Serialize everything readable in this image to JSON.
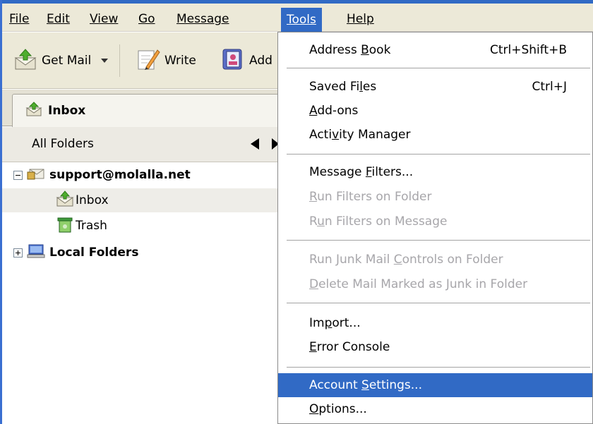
{
  "menubar": {
    "items": [
      {
        "id": "file",
        "label": "File"
      },
      {
        "id": "edit",
        "label": "Edit"
      },
      {
        "id": "view",
        "label": "View"
      },
      {
        "id": "go",
        "label": "Go"
      },
      {
        "id": "message",
        "label": "Message"
      },
      {
        "id": "tools",
        "label": "Tools"
      },
      {
        "id": "help",
        "label": "Help"
      }
    ]
  },
  "toolbar": {
    "get_mail": "Get Mail",
    "write": "Write",
    "address_book_partial": "Add"
  },
  "tab": {
    "label": "Inbox"
  },
  "folder_pane": {
    "header": "All Folders",
    "tree": [
      {
        "label": "support@molalla.net",
        "bold": true
      },
      {
        "label": "Inbox"
      },
      {
        "label": "Trash"
      },
      {
        "label": "Local Folders",
        "bold": true
      }
    ]
  },
  "tools_menu": {
    "address_book": {
      "pre": "Address ",
      "acc": "B",
      "post": "ook",
      "shortcut": "Ctrl+Shift+B"
    },
    "saved_files": {
      "pre": "Saved Fi",
      "acc": "l",
      "post": "es",
      "shortcut": "Ctrl+J"
    },
    "addons": {
      "pre": "",
      "acc": "A",
      "post": "dd-ons"
    },
    "activity_manager": {
      "pre": "Acti",
      "acc": "v",
      "post": "ity Manager"
    },
    "message_filters": {
      "pre": "Message ",
      "acc": "F",
      "post": "ilters..."
    },
    "run_filters_folder": {
      "pre": "",
      "acc": "R",
      "post": "un Filters on Folder"
    },
    "run_filters_message": {
      "pre": "R",
      "acc": "u",
      "post": "n Filters on Message"
    },
    "run_junk": {
      "pre": "Run Junk Mail ",
      "acc": "C",
      "post": "ontrols on Folder"
    },
    "delete_junk": {
      "pre": "",
      "acc": "D",
      "post": "elete Mail Marked as Junk in Folder"
    },
    "import": {
      "pre": "Im",
      "acc": "p",
      "post": "ort..."
    },
    "error_console": {
      "pre": "",
      "acc": "E",
      "post": "rror Console"
    },
    "account_settings": {
      "pre": "Account ",
      "acc": "S",
      "post": "ettings..."
    },
    "options": {
      "pre": "",
      "acc": "O",
      "post": "ptions..."
    }
  },
  "colors": {
    "highlight": "#316ac5",
    "menubar_bg": "#ece9d8",
    "disabled_text": "#a7a6aa"
  }
}
